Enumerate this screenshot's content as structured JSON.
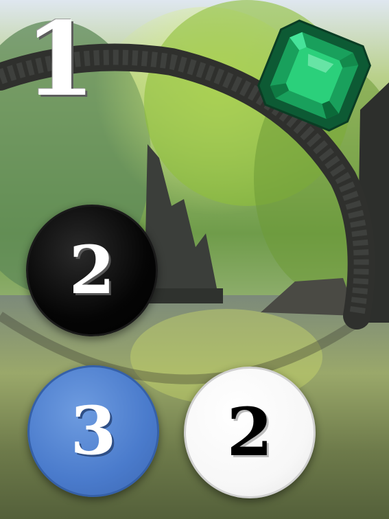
{
  "corner_number": "1",
  "tokens": {
    "black": {
      "value": "2",
      "color": "#000000"
    },
    "blue": {
      "value": "3",
      "color": "#4a7bcc"
    },
    "white": {
      "value": "2",
      "color": "#ffffff"
    }
  },
  "gem": {
    "icon": "emerald-gem-icon",
    "color": "#1aa863"
  },
  "background": {
    "icon": "stone-arch-bridge-lake-photo"
  }
}
